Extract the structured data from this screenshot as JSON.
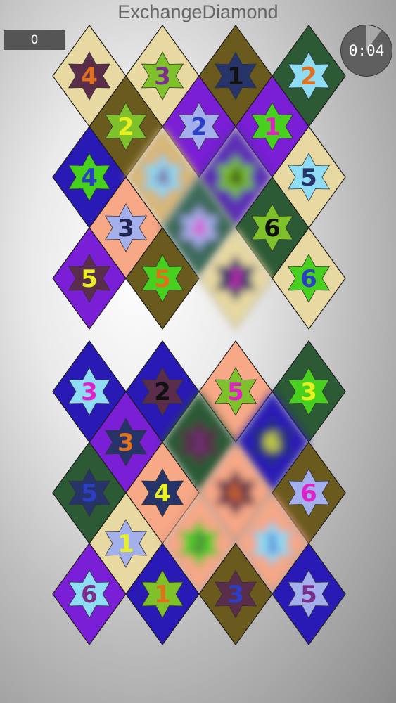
{
  "title": "ExchangeDiamond",
  "score": "0",
  "timer": {
    "text": "0:04",
    "elapsed_fraction": 0.1
  },
  "boards": [
    {
      "name": "upper",
      "rows": [
        {
          "pos": "even",
          "tiles": [
            {
              "bg": "#e8d9a3",
              "star": "#5a2d4b",
              "num": "4",
              "nc": "#e0701a"
            },
            {
              "bg": "#e8d9a3",
              "star": "#7ec12a",
              "num": "3",
              "nc": "#7a2d8a"
            },
            {
              "bg": "#6b5a1e",
              "star": "#26346a",
              "num": "1",
              "nc": "#111111"
            },
            {
              "bg": "#2c5a35",
              "star": "#8fdcf5",
              "num": "2",
              "nc": "#e0701a"
            }
          ]
        },
        {
          "pos": "odd",
          "tiles": [
            {
              "bg": "#6b5a1e",
              "star": "#7ec12a",
              "num": "2",
              "nc": "#e8f020"
            },
            {
              "bg": "#7a1fd6",
              "star": "#a4b0ec",
              "num": "2",
              "nc": "#2a3ec8"
            },
            {
              "bg": "#7a1fd6",
              "star": "#47d11e",
              "num": "1",
              "nc": "#e020c8"
            }
          ]
        },
        {
          "pos": "even",
          "tiles": [
            {
              "bg": "#2a1ab5",
              "star": "#47d11e",
              "num": "4",
              "nc": "#2a3ec8"
            },
            {
              "bg": "#d8b87a",
              "star": "#8fdcf5",
              "num": "4",
              "nc": "#7a2d8a",
              "blur": true
            },
            {
              "bg": "#5c2fb5",
              "star": "#7ec12a",
              "num": "4",
              "nc": "#111111",
              "blur": true
            },
            {
              "bg": "#e8d9a3",
              "star": "#8fdcf5",
              "num": "5",
              "nc": "#26346a"
            }
          ]
        },
        {
          "pos": "odd",
          "tiles": [
            {
              "bg": "#f7a887",
              "star": "#a4b0ec",
              "num": "3",
              "nc": "#1f2450"
            },
            {
              "bg": "#3d6a5a",
              "star": "#a4b0ec",
              "num": "4",
              "nc": "#e020c8",
              "blur": true
            },
            {
              "bg": "#2c5a35",
              "star": "#7ec12a",
              "num": "6",
              "nc": "#111111"
            }
          ]
        },
        {
          "pos": "even",
          "tiles": [
            {
              "bg": "#7a1fd6",
              "star": "#5a2d4b",
              "num": "5",
              "nc": "#e8f020"
            },
            {
              "bg": "#6b5a1e",
              "star": "#47d11e",
              "num": "5",
              "nc": "#e0701a"
            },
            {
              "bg": "#e8d9a3",
              "star": "#26346a",
              "num": "2",
              "nc": "#e020c8",
              "blur": true
            },
            {
              "bg": "#e8d9a3",
              "star": "#47d11e",
              "num": "6",
              "nc": "#2a3ec8"
            }
          ]
        }
      ]
    },
    {
      "name": "lower",
      "rows": [
        {
          "pos": "even",
          "tiles": [
            {
              "bg": "#2a1ab5",
              "star": "#8fdcf5",
              "num": "3",
              "nc": "#e020c8"
            },
            {
              "bg": "#2a1ab5",
              "star": "#5a2d4b",
              "num": "2",
              "nc": "#111111"
            },
            {
              "bg": "#f7a887",
              "star": "#7ec12a",
              "num": "5",
              "nc": "#e020c8"
            },
            {
              "bg": "#2c5a35",
              "star": "#47d11e",
              "num": "3",
              "nc": "#e8f020"
            }
          ]
        },
        {
          "pos": "odd",
          "tiles": [
            {
              "bg": "#7a1fd6",
              "star": "#26346a",
              "num": "3",
              "nc": "#e0701a"
            },
            {
              "bg": "#2c5a35",
              "star": "#5a2d4b",
              "num": "1",
              "nc": "#7a2d8a",
              "blur": true
            },
            {
              "bg": "#2a1ab5",
              "star": "#26346a",
              "num": "6",
              "nc": "#e8f020",
              "blur": true
            }
          ]
        },
        {
          "pos": "even",
          "tiles": [
            {
              "bg": "#2c5a35",
              "star": "#26346a",
              "num": "5",
              "nc": "#2a3ec8"
            },
            {
              "bg": "#f7a887",
              "star": "#26346a",
              "num": "4",
              "nc": "#e8f020"
            },
            {
              "bg": "#f7a887",
              "star": "#5a2d4b",
              "num": "6",
              "nc": "#e0701a",
              "blur": true
            },
            {
              "bg": "#6b5a1e",
              "star": "#a4b0ec",
              "num": "6",
              "nc": "#e020c8"
            }
          ]
        },
        {
          "pos": "odd",
          "tiles": [
            {
              "bg": "#e8d9a3",
              "star": "#a4b0ec",
              "num": "1",
              "nc": "#e8f020"
            },
            {
              "bg": "#f7a887",
              "star": "#47d11e",
              "num": "2",
              "nc": "#5a2d4b",
              "blur": true
            },
            {
              "bg": "#f7a887",
              "star": "#8fdcf5",
              "num": "1",
              "nc": "#2a3ec8",
              "blur": true
            }
          ]
        },
        {
          "pos": "even",
          "tiles": [
            {
              "bg": "#7a1fd6",
              "star": "#8fdcf5",
              "num": "6",
              "nc": "#7a2d8a"
            },
            {
              "bg": "#2a1ab5",
              "star": "#7ec12a",
              "num": "1",
              "nc": "#e0701a"
            },
            {
              "bg": "#6b5a1e",
              "star": "#5a2d4b",
              "num": "3",
              "nc": "#2a3ec8"
            },
            {
              "bg": "#2a1ab5",
              "star": "#a4b0ec",
              "num": "5",
              "nc": "#7a2d8a"
            }
          ]
        }
      ]
    }
  ]
}
